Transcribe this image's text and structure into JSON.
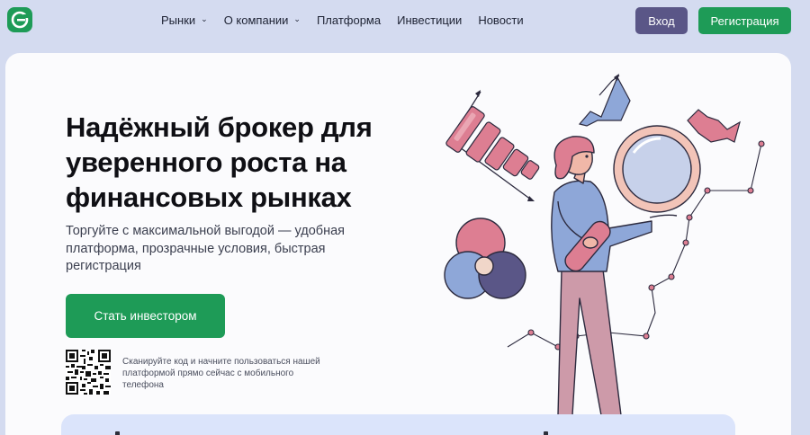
{
  "header": {
    "logo_icon": "brand-e-icon",
    "nav": [
      {
        "label": "Рынки",
        "has_dropdown": true
      },
      {
        "label": "О компании",
        "has_dropdown": true
      },
      {
        "label": "Платформа",
        "has_dropdown": false
      },
      {
        "label": "Инвестиции",
        "has_dropdown": false
      },
      {
        "label": "Новости",
        "has_dropdown": false
      }
    ],
    "login_label": "Вход",
    "register_label": "Регистрация"
  },
  "hero": {
    "title": "Надёжный брокер для уверенного роста на финансовых рынках",
    "subtitle": "Торгуйте с максимальной выгодой — удобная платформа, прозрачные условия, быстрая регистрация",
    "cta_label": "Стать инвестором",
    "qr_caption": "Сканируйте код и начните пользоваться нашей платформой прямо сейчас с мобильного телефона"
  },
  "colors": {
    "brand_green": "#1e9b57",
    "login_purple": "#5a5687",
    "page_bg": "#d4dbf0",
    "accent_pink": "#dd7e92",
    "accent_blue": "#8ea7d8"
  }
}
